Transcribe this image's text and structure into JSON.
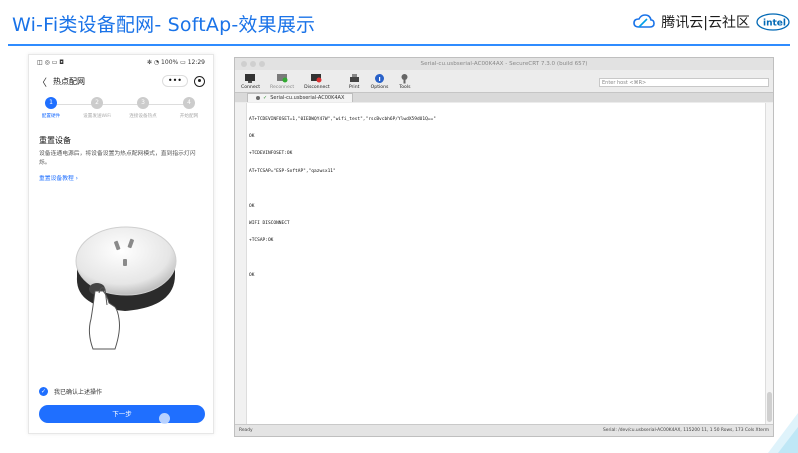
{
  "slide": {
    "title": "Wi-Fi类设备配网- SoftAp-效果展示",
    "brand": "腾讯云|云社区"
  },
  "colors": {
    "accent": "#1f6fff",
    "title": "#1a73e8",
    "rule": "#2f8cff"
  },
  "phone": {
    "status_left": "◫ ◎ ▭ ◘",
    "status_right": "✻ ◔ 100% ▭ 12:29",
    "nav": {
      "back": "〈",
      "title": "热点配网",
      "more": "•••"
    },
    "steps": [
      {
        "num": "1",
        "label": "配置硬件"
      },
      {
        "num": "2",
        "label": "设置发送WiFi"
      },
      {
        "num": "3",
        "label": "连接设备热点"
      },
      {
        "num": "4",
        "label": "开始配网"
      }
    ],
    "heading": "重置设备",
    "desc": "设备连通电源后，将设备设置为热点配网模式，直到指示灯闪烁。",
    "link": "重置设备教程 ›",
    "confirm": "我已确认上述操作",
    "next_button": "下一步"
  },
  "terminal": {
    "window_title": "Serial-cu.usbserial-AC00K4AX - SecureCRT 7.3.0 (build 657)",
    "toolbar": [
      {
        "label": "Connect",
        "icon": "connect-icon"
      },
      {
        "label": "Reconnect",
        "icon": "reconnect-icon"
      },
      {
        "label": "Disconnect",
        "icon": "disconnect-icon"
      },
      {
        "label": "Print",
        "icon": "print-icon"
      },
      {
        "label": "Options",
        "icon": "options-icon"
      },
      {
        "label": "Tools",
        "icon": "tools-icon"
      }
    ],
    "host_placeholder": "Enter host <⌘R>",
    "tab": "Serial-cu.usbserial-AC00K4AX",
    "lines": [
      "AT+TCDEVINFOSET=1,\"0IEDWQY47W\",\"wifi_test\",\"rscBvcbh6P/YlwdX59dU1Q==\"",
      "OK",
      "+TCDEVINFOSET:OK",
      "AT+TCSAP=\"ESP-SoftAP\",\"qazwsx11\"",
      "",
      "OK",
      "WIFI DISCONNECT",
      "+TCSAP:OK",
      "",
      "OK"
    ],
    "status_left": "Ready",
    "status_right": "Serial: /dev/cu.usbserial-AC00K4AX, 115200   11, 1   50 Rows, 173 Cols   Xterm"
  }
}
